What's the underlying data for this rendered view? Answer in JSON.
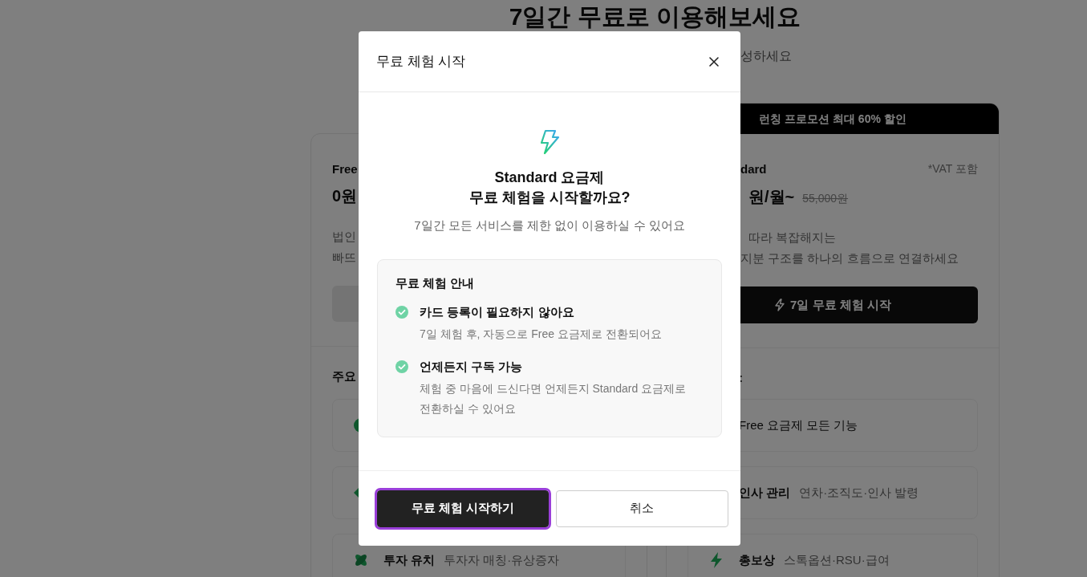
{
  "page": {
    "title": "7일간 무료로 이용해보세요",
    "subtitle": "성하세요"
  },
  "plans": [
    {
      "name": "Free",
      "price": "0원",
      "description": [
        "법인",
        "빠뜨"
      ],
      "features_heading": "주요",
      "features": [
        {
          "kind": "circle"
        },
        {
          "kind": "diamond"
        },
        {
          "kind": "leaf",
          "title": "투자 유치",
          "desc": "투자자 매칭·유상증자"
        }
      ]
    },
    {
      "banner": "런칭 프로모션 최대 60% 할인",
      "name": "dard",
      "vat_note": "*VAT 포함",
      "price": "원/월~",
      "original_price": "55,000원",
      "description": [
        "따라 복잡해지는",
        "지분 구조를 하나의 흐름으로 연결하세요"
      ],
      "button": "7일 무료 체험 시작",
      "features_heading": ":",
      "features": [
        {
          "title": "Free 요금제 모든 기능"
        },
        {
          "title": "인사 관리",
          "desc": "연차·조직도·인사 발령"
        },
        {
          "kind": "bolt",
          "title": "총보상",
          "desc": "스톡옵션·RSU·급여"
        }
      ]
    }
  ],
  "modal": {
    "title": "무료 체험 시작",
    "heading": [
      "Standard 요금제",
      "무료 체험을 시작할까요?"
    ],
    "subtitle": "7일간 모든 서비스를 제한 없이 이용하실 수 있어요",
    "info": {
      "title": "무료 체험 안내",
      "items": [
        {
          "title": "카드 등록이 필요하지 않아요",
          "desc": "7일 체험 후, 자동으로 Free 요금제로 전환되어요"
        },
        {
          "title": "언제든지 구독 가능",
          "desc": "체험 중 마음에 드신다면 언제든지 Standard 요금제로 전환하실 수 있어요"
        }
      ]
    },
    "buttons": [
      {
        "kind": "primary",
        "label": "무료 체험 시작하기",
        "focused": true
      },
      {
        "kind": "secondary",
        "label": "취소",
        "focused": false
      }
    ]
  }
}
